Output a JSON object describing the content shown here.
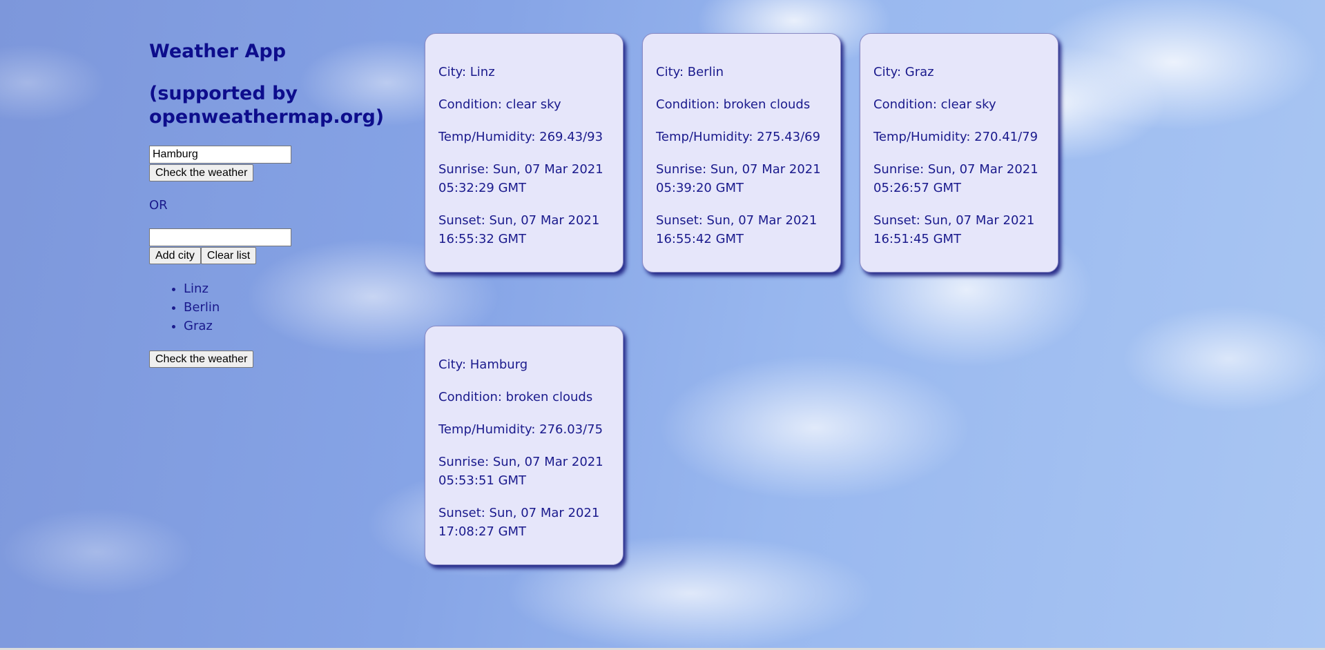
{
  "app": {
    "title": "Weather App",
    "subtitle": "(supported by openweathermap.org)"
  },
  "single_search": {
    "input_value": "Hamburg",
    "check_button": "Check the weather"
  },
  "or_label": "OR",
  "multi_search": {
    "input_value": "",
    "add_button": "Add city",
    "clear_button": "Clear list",
    "cities": [
      "Linz",
      "Berlin",
      "Graz"
    ],
    "check_button": "Check the weather"
  },
  "cards": [
    {
      "city": "City: Linz",
      "condition": "Condition: clear sky",
      "temp_humidity": "Temp/Humidity: 269.43/93",
      "sunrise": "Sunrise: Sun, 07 Mar 2021 05:32:29 GMT",
      "sunset": "Sunset: Sun, 07 Mar 2021 16:55:32 GMT"
    },
    {
      "city": "City: Berlin",
      "condition": "Condition: broken clouds",
      "temp_humidity": "Temp/Humidity: 275.43/69",
      "sunrise": "Sunrise: Sun, 07 Mar 2021 05:39:20 GMT",
      "sunset": "Sunset: Sun, 07 Mar 2021 16:55:42 GMT"
    },
    {
      "city": "City: Graz",
      "condition": "Condition: clear sky",
      "temp_humidity": "Temp/Humidity: 270.41/79",
      "sunrise": "Sunrise: Sun, 07 Mar 2021 05:26:57 GMT",
      "sunset": "Sunset: Sun, 07 Mar 2021 16:51:45 GMT"
    },
    {
      "city": "City: Hamburg",
      "condition": "Condition: broken clouds",
      "temp_humidity": "Temp/Humidity: 276.03/75",
      "sunrise": "Sunrise: Sun, 07 Mar 2021 05:53:51 GMT",
      "sunset": "Sunset: Sun, 07 Mar 2021 17:08:27 GMT"
    }
  ],
  "colors": {
    "text": "#1a1a8c",
    "card_background": "#e6e6fa",
    "sky": "#86a4e6"
  }
}
